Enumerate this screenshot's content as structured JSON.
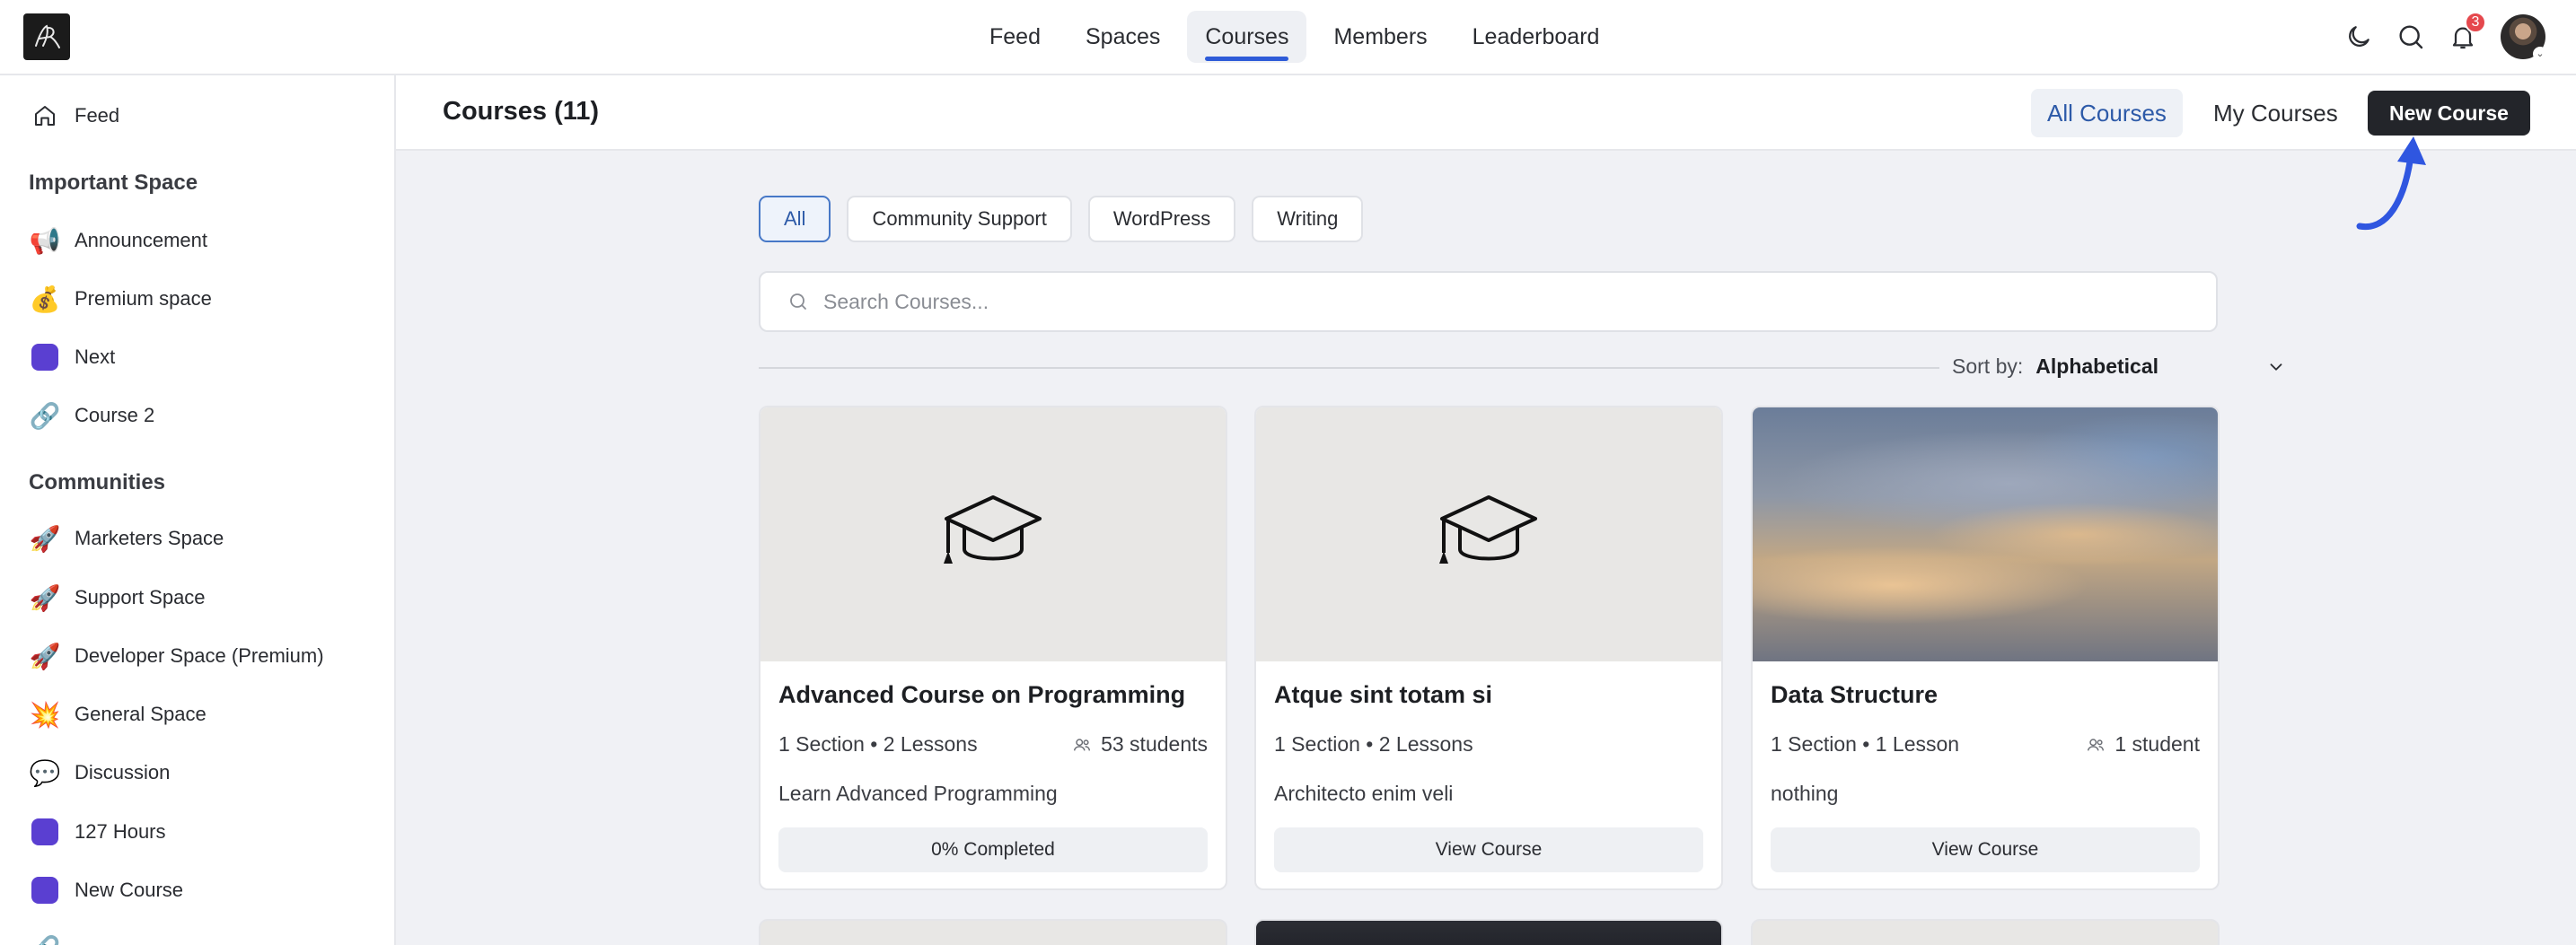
{
  "topnav": {
    "items": [
      {
        "label": "Feed"
      },
      {
        "label": "Spaces"
      },
      {
        "label": "Courses",
        "active": true
      },
      {
        "label": "Members"
      },
      {
        "label": "Leaderboard"
      }
    ]
  },
  "topbar": {
    "notification_count": "3",
    "icons": [
      "moon-icon",
      "search-icon",
      "bell-icon"
    ]
  },
  "sidebar": {
    "feed_label": "Feed",
    "important_heading": "Important Space",
    "important_items": [
      {
        "label": "Announcement",
        "icon": "megaphone-emoji"
      },
      {
        "label": "Premium space",
        "icon": "money-bag-emoji"
      },
      {
        "label": "Next",
        "icon": "purple-square"
      },
      {
        "label": "Course 2",
        "icon": "link-emoji"
      }
    ],
    "communities_heading": "Communities",
    "community_items": [
      {
        "label": "Marketers Space",
        "icon": "rocket-emoji"
      },
      {
        "label": "Support Space",
        "icon": "rocket-emoji"
      },
      {
        "label": "Developer Space (Premium)",
        "icon": "rocket-emoji"
      },
      {
        "label": "General Space",
        "icon": "collision-emoji"
      },
      {
        "label": "Discussion",
        "icon": "speech-bubble-emoji"
      },
      {
        "label": "127 Hours",
        "icon": "purple-square"
      },
      {
        "label": "New Course",
        "icon": "purple-square"
      }
    ]
  },
  "header": {
    "title": "Courses (11)",
    "all_courses": "All Courses",
    "my_courses": "My Courses",
    "new_course": "New Course"
  },
  "filters": [
    {
      "label": "All",
      "active": true
    },
    {
      "label": "Community Support"
    },
    {
      "label": "WordPress"
    },
    {
      "label": "Writing"
    }
  ],
  "search": {
    "placeholder": "Search Courses...",
    "value": ""
  },
  "sort": {
    "label": "Sort by:",
    "value": "Alphabetical"
  },
  "courses": [
    {
      "title": "Advanced Course on Programming",
      "meta": "1 Section • 2 Lessons",
      "students": "53 students",
      "description": "Learn Advanced Programming",
      "action": "0% Completed",
      "thumbnail": "graduation-cap-placeholder"
    },
    {
      "title": "Atque sint totam si",
      "meta": "1 Section • 2 Lessons",
      "students": "",
      "description": "Architecto enim veli",
      "action": "View Course",
      "thumbnail": "graduation-cap-placeholder"
    },
    {
      "title": "Data Structure",
      "meta": "1 Section • 1 Lesson",
      "students": "1 student",
      "description": "nothing",
      "action": "View Course",
      "thumbnail": "cloudy-sky-photo"
    }
  ],
  "colors": {
    "accent": "#2e5bd8",
    "primary_button": "#23252a",
    "badge": "#e5484d",
    "space_icon": "#5a3fd1"
  }
}
